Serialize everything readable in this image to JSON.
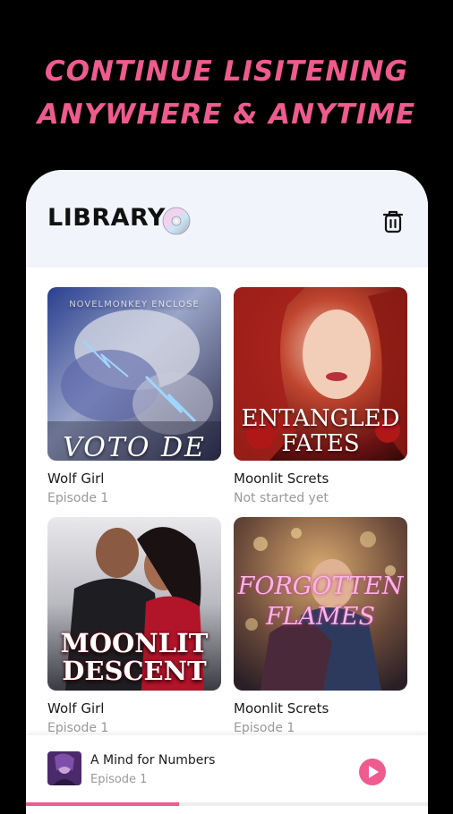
{
  "promo": {
    "line1": "CONTINUE LISITENING",
    "line2": "ANYWHERE & ANYTIME"
  },
  "colors": {
    "accent": "#ef5b8e",
    "background": "#000000",
    "header_bg": "#f1f4fb"
  },
  "library": {
    "title": "LIBRARY",
    "title_icon": "disc-icon",
    "action_icon": "trash-icon"
  },
  "books": [
    {
      "title": "Wolf Girl",
      "subtitle": "Episode 1",
      "cover_top_text": "NOVELMONKEY ENCLOSE",
      "cover_text": "VOTO DE"
    },
    {
      "title": "Moonlit Screts",
      "subtitle": "Not started yet",
      "cover_text_1": "ENTANGLED",
      "cover_text_2": "FATES"
    },
    {
      "title": "Wolf Girl",
      "subtitle": "Episode 1",
      "cover_text_1": "MOONLIT",
      "cover_text_2": "DESCENT"
    },
    {
      "title": "Moonlit Screts",
      "subtitle": "Episode 1",
      "cover_text_1": "FORGOTTEN",
      "cover_text_2": "FLAMES"
    }
  ],
  "player": {
    "title": "A Mind for Numbers",
    "subtitle": "Episode 1",
    "play_icon": "play-icon",
    "progress": 0.38
  }
}
